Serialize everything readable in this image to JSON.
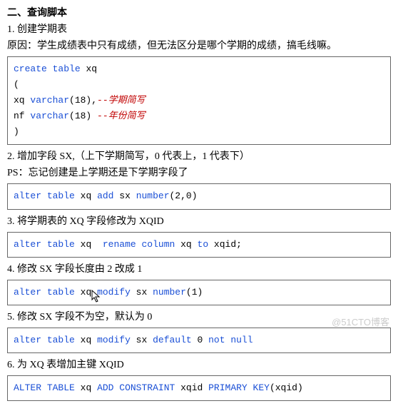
{
  "heading": "二、查询脚本",
  "item1": {
    "title": "1.  创建学期表",
    "reason": "原因：学生成绩表中只有成绩，但无法区分是哪个学期的成绩，搞毛线嘛。",
    "code": {
      "l1_kw1": "create",
      "l1_kw2": "table",
      "l1_id": " xq",
      "l2": "(",
      "l3_id": "xq ",
      "l3_kw": "varchar",
      "l3_rest": "(18),",
      "l3_cmt": "--学期简写",
      "l4_id": "nf ",
      "l4_kw": "varchar",
      "l4_rest": "(18) ",
      "l4_cmt": "--年份简写",
      "l5": ")"
    }
  },
  "item2": {
    "title": "2.  增加字段 SX,（上下学期简写，0 代表上，1 代表下）",
    "ps": "PS：忘记创建是上学期还是下学期字段了",
    "code": {
      "kw1": "alter",
      "kw2": "table",
      "id1": " xq ",
      "kw3": "add",
      "id2": " sx ",
      "kw4": "number",
      "rest": "(2,0)"
    }
  },
  "item3": {
    "title": "3.  将学期表的 XQ 字段修改为 XQID",
    "code": {
      "kw1": "alter",
      "kw2": "table",
      "id1": " xq  ",
      "kw3": "rename",
      "kw4": "column",
      "id2": " xq ",
      "kw5": "to",
      "id3": " xqid;"
    }
  },
  "item4": {
    "title": "4.  修改 SX 字段长度由 2 改成 1",
    "code": {
      "kw1": "alter",
      "kw2": "table",
      "id1": " xq ",
      "kw3": "modify",
      "id2": " sx ",
      "kw4": "number",
      "rest": "(1)"
    }
  },
  "item5": {
    "title": "5.  修改 SX 字段不为空，默认为 0",
    "code": {
      "kw1": "alter",
      "kw2": "table",
      "id1": " xq ",
      "kw3": "modify",
      "id2": " sx ",
      "kw4": "default",
      "num": " 0 ",
      "kw5": "not",
      "kw6": "null"
    }
  },
  "item6": {
    "title": "6.  为 XQ 表增加主键 XQID",
    "code": {
      "kw1": "ALTER",
      "kw2": "TABLE",
      "id1": " xq ",
      "kw3": "ADD",
      "kw4": "CONSTRAINT",
      "id2": " xqid ",
      "kw5": "PRIMARY",
      "kw6": "KEY",
      "rest": "(xqid)"
    }
  },
  "watermark": "@51CTO博客"
}
